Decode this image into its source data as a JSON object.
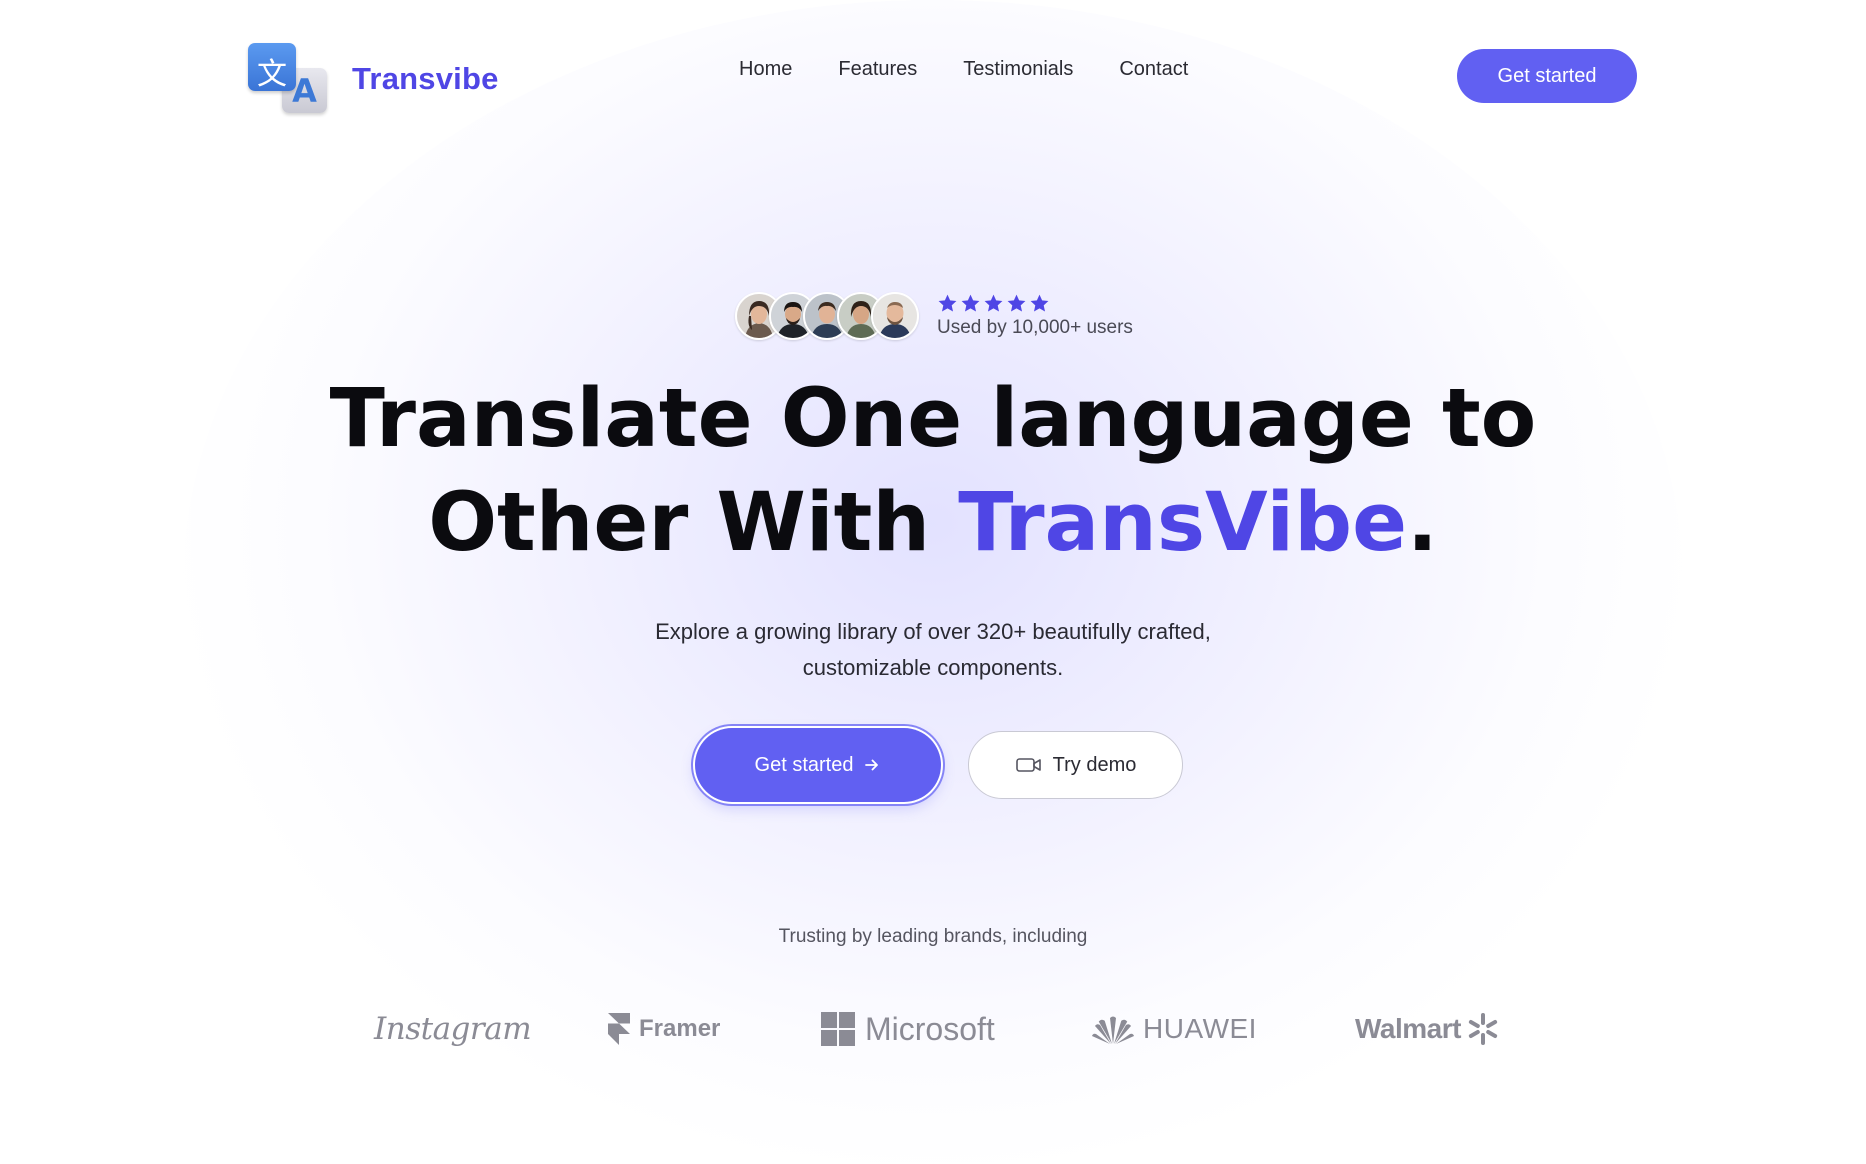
{
  "brand": {
    "name": "Transvibe",
    "logo_icon": "translate-icon",
    "logo_glyph_front": "文",
    "logo_glyph_back": "A"
  },
  "nav": {
    "links": [
      "Home",
      "Features",
      "Testimonials",
      "Contact"
    ],
    "cta_label": "Get started"
  },
  "social_proof": {
    "avatar_count": 5,
    "rating": 5,
    "label": "Used by 10,000+ users"
  },
  "hero": {
    "headline_line1": "Translate One language to",
    "headline_line2_prefix": "Other With ",
    "headline_accent": "TransVibe",
    "headline_suffix": ".",
    "subtitle_line1": "Explore a growing library of over 320+ beautifully crafted,",
    "subtitle_line2": "customizable components.",
    "primary_button": "Get started",
    "primary_button_icon": "arrow-right-icon",
    "secondary_button": "Try demo",
    "secondary_button_icon": "video-camera-icon"
  },
  "brands": {
    "caption": "Trusting by leading brands, including",
    "logos": [
      "Instagram",
      "Framer",
      "Microsoft",
      "HUAWEI",
      "Walmart"
    ]
  },
  "colors": {
    "accent": "#4f46e5",
    "button": "#6160f2",
    "star": "#4f46e5",
    "brand_gray": "#8b8b95"
  }
}
